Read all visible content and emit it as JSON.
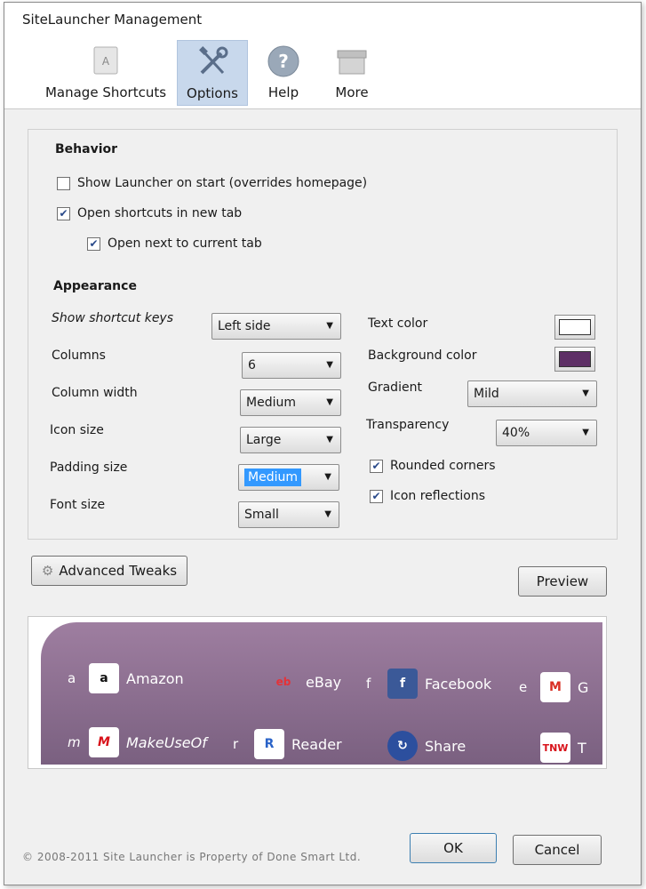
{
  "window": {
    "title": "SiteLauncher Management"
  },
  "toolbar": {
    "items": [
      {
        "label": "Manage Shortcuts",
        "icon": "shortcut-a-icon"
      },
      {
        "label": "Options",
        "icon": "tools-icon"
      },
      {
        "label": "Help",
        "icon": "help-icon"
      },
      {
        "label": "More",
        "icon": "box-icon"
      }
    ],
    "active": "Options"
  },
  "behavior": {
    "title": "Behavior",
    "show_launcher": {
      "label": "Show Launcher on start (overrides homepage)",
      "checked": false
    },
    "open_new_tab": {
      "label": "Open shortcuts in new tab",
      "checked": true
    },
    "open_next": {
      "label": "Open next to current tab",
      "checked": true
    }
  },
  "appearance": {
    "title": "Appearance",
    "shortcut_keys": {
      "label": "Show shortcut keys",
      "value": "Left side"
    },
    "columns": {
      "label": "Columns",
      "value": "6"
    },
    "column_width": {
      "label": "Column width",
      "value": "Medium"
    },
    "icon_size": {
      "label": "Icon size",
      "value": "Large"
    },
    "padding_size": {
      "label": "Padding size",
      "value": "Medium"
    },
    "font_size": {
      "label": "Font size",
      "value": "Small"
    },
    "text_color": {
      "label": "Text color",
      "color": "#ffffff"
    },
    "background_color": {
      "label": "Background color",
      "color": "#5e2f66"
    },
    "gradient": {
      "label": "Gradient",
      "value": "Mild"
    },
    "transparency": {
      "label": "Transparency",
      "value": "40%"
    },
    "rounded_corners": {
      "label": "Rounded corners",
      "checked": true
    },
    "icon_reflections": {
      "label": "Icon reflections",
      "checked": true
    }
  },
  "buttons": {
    "advanced": "Advanced Tweaks",
    "preview": "Preview",
    "ok": "OK",
    "cancel": "Cancel"
  },
  "preview": {
    "shortcuts": [
      {
        "key": "a",
        "name": "Amazon",
        "icon": "amazon-icon"
      },
      {
        "key": "",
        "name": "eBay",
        "icon": "ebay-icon"
      },
      {
        "key": "f",
        "name": "Facebook",
        "icon": "facebook-icon"
      },
      {
        "key": "e",
        "name": "G",
        "icon": "gmail-icon"
      },
      {
        "key": "m",
        "name": "MakeUseOf",
        "icon": "makeuseof-icon"
      },
      {
        "key": "r",
        "name": "Reader",
        "icon": "reader-icon"
      },
      {
        "key": "",
        "name": "Share",
        "icon": "share-icon"
      },
      {
        "key": "",
        "name": "T",
        "icon": "tnw-icon"
      }
    ]
  },
  "footer": {
    "copyright": "© 2008-2011 Site Launcher is Property of Done Smart Ltd."
  }
}
